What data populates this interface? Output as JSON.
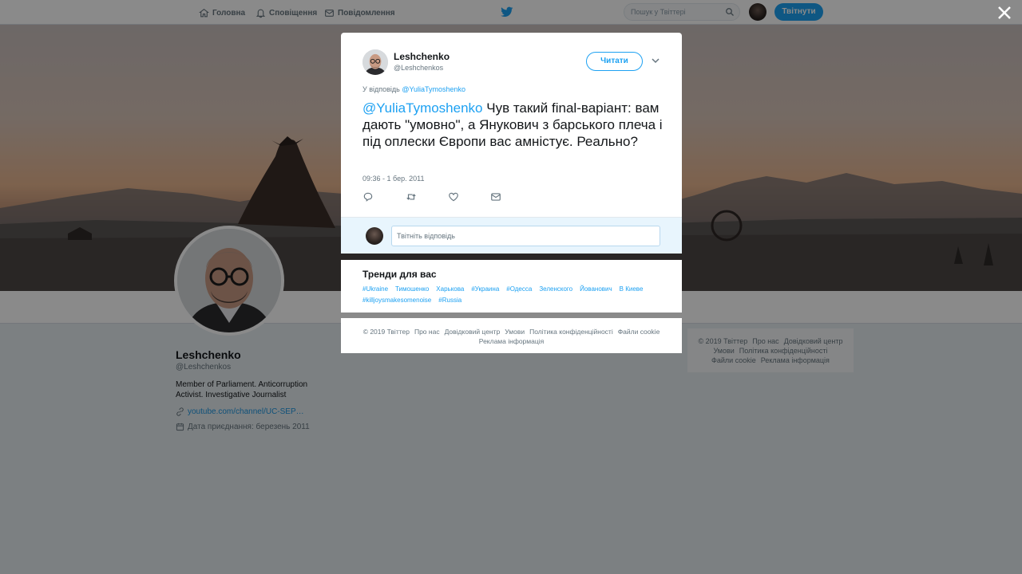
{
  "topnav": {
    "home_label": "Головна",
    "notifications_label": "Сповіщення",
    "messages_label": "Повідомлення",
    "search_placeholder": "Пошук у Твіттері",
    "tweet_button": "Твітнути",
    "icons": [
      "home-icon",
      "bell-icon",
      "envelope-icon",
      "twitter-bird-icon",
      "search-icon"
    ]
  },
  "profile": {
    "name": "Leshchenko",
    "handle": "@Leshchenkos",
    "bio": "Member of Parliament. Anticorruption Activist. Investigative Journalist",
    "link": "youtube.com/channel/UC-SEP…",
    "joined": "Дата приєднання: березень 2011"
  },
  "right_footer": {
    "items": [
      "© 2019 Твіттер",
      "Про нас",
      "Довідковий центр",
      "Умови",
      "Політика конфіденційності",
      "Файли cookie",
      "Реклама інформація"
    ]
  },
  "modal": {
    "author_name": "Leshchenko",
    "author_handle": "@Leshchenkos",
    "follow_label": "Читати",
    "reply_to_prefix": "У відповідь",
    "reply_to_mention": "@YuliaTymoshenko",
    "tweet_mention": "@YuliaTymoshenko",
    "tweet_text": " Чув такий final-варіант: вам дають \"умовно\", а Янукович з барського плеча і під оплески Європи вас амністує. Реально?",
    "timestamp": "09:36 - 1 бер. 2011",
    "reply_placeholder": "Твітніть відповідь"
  },
  "trends": {
    "title": "Тренди для вас",
    "items": [
      "#Ukraine",
      "Тимошенко",
      "Харькова",
      "#Украина",
      "#Одесса",
      "Зеленского",
      "Йованович",
      "В Киеве",
      "#killjoysmakesomenoise",
      "#Russia"
    ]
  },
  "modal_footer": {
    "items": [
      "© 2019 Твіттер",
      "Про нас",
      "Довідковий центр",
      "Умови",
      "Політика конфіденційності",
      "Файли cookie",
      "Реклама інформація"
    ]
  },
  "colors": {
    "accent": "#1da1f2",
    "overlay": "rgba(0,0,0,0.46)"
  }
}
